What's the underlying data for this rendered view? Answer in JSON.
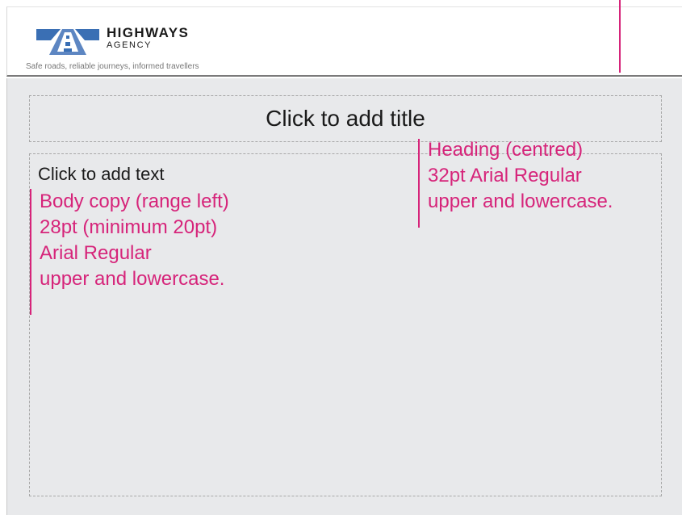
{
  "header": {
    "brand_name": "HIGHWAYS",
    "brand_sub": "AGENCY",
    "tagline": "Safe roads, reliable journeys, informed travellers",
    "logo_icon": "highways-agency-logo-icon",
    "logo_colors": [
      "#3a6fb4",
      "#6a8fc4"
    ]
  },
  "slide": {
    "title_placeholder": "Click to add title",
    "body_placeholder": "Click to add text"
  },
  "annotations": {
    "body": [
      "Body copy (range left)",
      "28pt (minimum 20pt)",
      "Arial Regular",
      "upper and lowercase."
    ],
    "heading": [
      "Heading (centred)",
      "32pt Arial Regular",
      "upper and lowercase."
    ],
    "color": "#d6247a"
  }
}
